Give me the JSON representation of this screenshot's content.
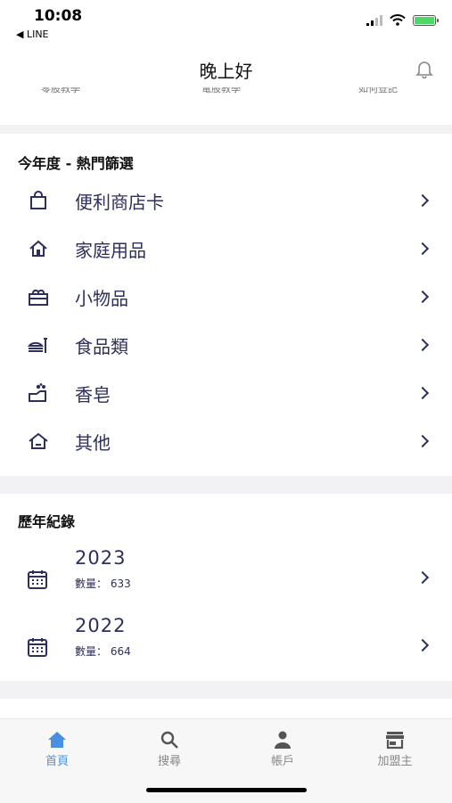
{
  "status": {
    "time": "10:08",
    "back_app": "◀ LINE"
  },
  "header": {
    "title": "晚上好",
    "peek": [
      "零股教學",
      "電股教學",
      "如何登記"
    ]
  },
  "hot_section": {
    "title": "今年度 - 熱門篩選",
    "items": [
      {
        "label": "便利商店卡",
        "icon": "shopping-bag-icon"
      },
      {
        "label": "家庭用品",
        "icon": "house-icon"
      },
      {
        "label": "小物品",
        "icon": "gift-box-icon"
      },
      {
        "label": "食品類",
        "icon": "food-icon"
      },
      {
        "label": "香皂",
        "icon": "soap-icon"
      },
      {
        "label": "其他",
        "icon": "other-icon"
      }
    ]
  },
  "history": {
    "title": "歷年紀錄",
    "items": [
      {
        "year": "2023",
        "count_label": "數量：",
        "count": "633"
      },
      {
        "year": "2022",
        "count_label": "數量：",
        "count": "664"
      }
    ]
  },
  "tabs": [
    {
      "label": "首頁",
      "icon": "home-icon",
      "active": true
    },
    {
      "label": "搜尋",
      "icon": "search-icon",
      "active": false
    },
    {
      "label": "帳戶",
      "icon": "account-icon",
      "active": false
    },
    {
      "label": "加盟主",
      "icon": "store-icon",
      "active": false
    }
  ],
  "colors": {
    "accent": "#4a90e2",
    "text": "#2d2f5e",
    "background": "#f2f2f4"
  }
}
